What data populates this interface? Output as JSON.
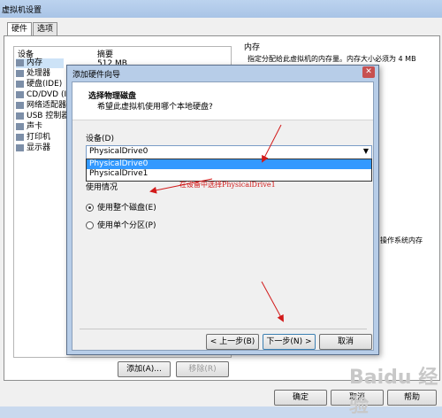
{
  "window": {
    "title": "虚拟机设置"
  },
  "tabs": [
    {
      "label": "硬件"
    },
    {
      "label": "选项"
    }
  ],
  "device_list": {
    "col_device": "设备",
    "col_summary": "摘要",
    "summary_first": "512 MB",
    "items": [
      {
        "label": "内存"
      },
      {
        "label": "处理器"
      },
      {
        "label": "硬盘(IDE)"
      },
      {
        "label": "CD/DVD (ID"
      },
      {
        "label": "网络适配器"
      },
      {
        "label": "USB 控制器"
      },
      {
        "label": "声卡"
      },
      {
        "label": "打印机"
      },
      {
        "label": "显示器"
      }
    ]
  },
  "memory_panel": {
    "heading": "内存",
    "description": "指定分配给此虚拟机的内存量。内存大小必须为 4 MB",
    "partial_text": "操作系统内存"
  },
  "bottom_buttons": {
    "add": "添加(A)...",
    "remove": "移除(R)",
    "ok": "确定",
    "cancel": "取消",
    "help": "帮助"
  },
  "dialog": {
    "title": "添加硬件向导",
    "close_glyph": "✕",
    "header_title": "选择物理磁盘",
    "header_subtitle": "希望此虚拟机使用哪个本地硬盘?",
    "device_label": "设备(D)",
    "selected_value": "PhysicalDrive0",
    "options": [
      "PhysicalDrive0",
      "PhysicalDrive1"
    ],
    "usage_label": "使用情况",
    "radio_whole_disk": "使用整个磁盘(E)",
    "radio_partition": "使用单个分区(P)",
    "radio_selected": "whole_disk",
    "back_button": "< 上一步(B)",
    "next_button": "下一步(N) >",
    "cancel_button": "取消"
  },
  "annotation": {
    "text": "在设备中选择PhysicalDrive1",
    "color": "#d21a1a"
  },
  "watermark": {
    "text": "Baidu 经验"
  },
  "colors": {
    "accent_select": "#3399ff",
    "title_bar": "#b7cde8",
    "arrow": "#d21a1a"
  }
}
